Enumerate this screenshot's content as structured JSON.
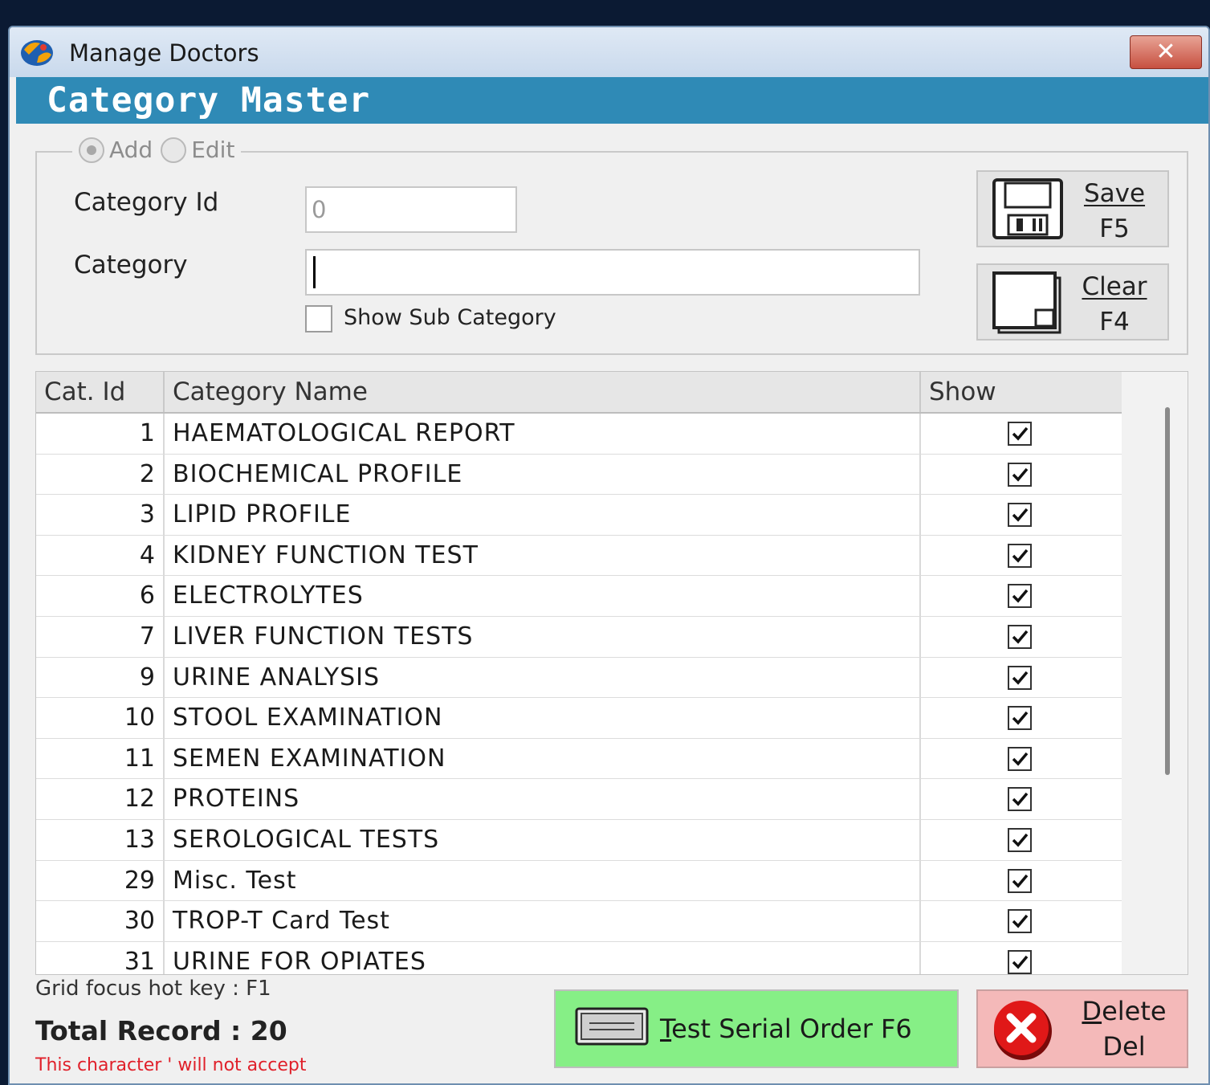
{
  "window": {
    "title": "Manage Doctors",
    "close_glyph": "✕"
  },
  "header": {
    "title": "Category Master"
  },
  "mode": {
    "add_label": "Add",
    "edit_label": "Edit",
    "selected": "Add"
  },
  "form": {
    "category_id_label": "Category Id",
    "category_id_value": "0",
    "category_label": "Category",
    "category_value": "",
    "show_sub_category_label": "Show Sub Category",
    "show_sub_category_checked": false
  },
  "buttons": {
    "save": {
      "label": "Save",
      "shortcut": "F5",
      "icon": "floppy-disk-icon"
    },
    "clear": {
      "label": "Clear",
      "shortcut": "F4",
      "icon": "blank-page-icon"
    },
    "serial": {
      "label": "Test Serial Order F6",
      "icon": "keyboard-icon",
      "color": "#86ef86"
    },
    "delete": {
      "label": "Delete",
      "shortcut": "Del",
      "icon": "red-x-icon",
      "color": "#f4b9b9"
    }
  },
  "grid": {
    "columns": [
      "Cat. Id",
      "Category Name",
      "Show"
    ],
    "rows": [
      {
        "id": "1",
        "name": "HAEMATOLOGICAL REPORT",
        "show": true
      },
      {
        "id": "2",
        "name": "BIOCHEMICAL PROFILE",
        "show": true
      },
      {
        "id": "3",
        "name": "LIPID PROFILE",
        "show": true
      },
      {
        "id": "4",
        "name": "KIDNEY FUNCTION TEST",
        "show": true
      },
      {
        "id": "6",
        "name": "ELECTROLYTES",
        "show": true
      },
      {
        "id": "7",
        "name": "LIVER FUNCTION TESTS",
        "show": true
      },
      {
        "id": "9",
        "name": "URINE ANALYSIS",
        "show": true
      },
      {
        "id": "10",
        "name": "STOOL EXAMINATION",
        "show": true
      },
      {
        "id": "11",
        "name": "SEMEN EXAMINATION",
        "show": true
      },
      {
        "id": "12",
        "name": "PROTEINS",
        "show": true
      },
      {
        "id": "13",
        "name": "SEROLOGICAL TESTS",
        "show": true
      },
      {
        "id": "29",
        "name": "Misc. Test",
        "show": true
      },
      {
        "id": "30",
        "name": "TROP-T Card Test",
        "show": true
      },
      {
        "id": "31",
        "name": "URINE FOR OPIATES",
        "show": true
      }
    ]
  },
  "footer": {
    "hotkey_note": "Grid focus hot key : F1",
    "total_record": "Total Record : 20",
    "warning": "This character ' will not accept"
  },
  "colors": {
    "header_band": "#2f8ab6",
    "warning": "#e0202a"
  }
}
